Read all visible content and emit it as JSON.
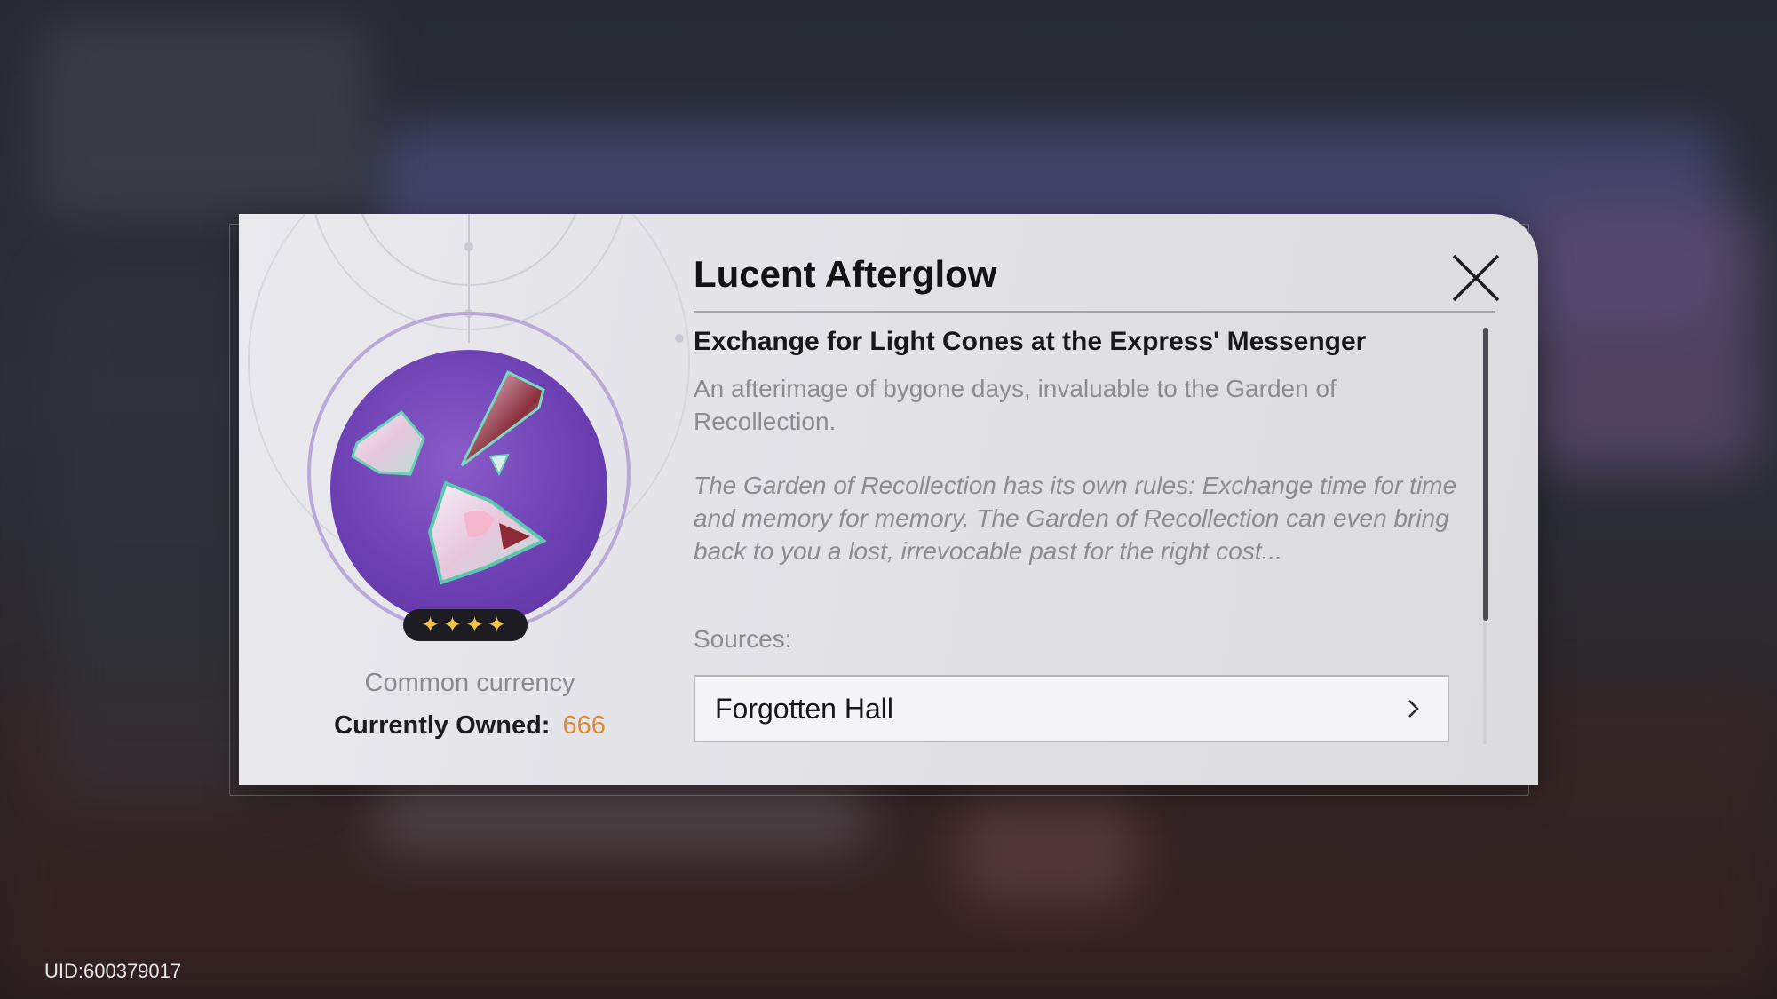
{
  "item": {
    "name": "Lucent Afterglow",
    "rarity_stars": "✦✦✦✦",
    "currency_type": "Common currency",
    "owned_label": "Currently Owned:",
    "owned_value": "666",
    "subtitle": "Exchange for Light Cones at the Express' Messenger",
    "description": "An afterimage of bygone days, invaluable to the Garden of Recollection.",
    "lore": "The Garden of Recollection has its own rules: Exchange time for time and memory for memory. The Garden of Recollection can even bring back to you a lost, irrevocable past for the right cost...",
    "sources_label": "Sources:",
    "sources": [
      {
        "label": "Forgotten Hall"
      }
    ]
  },
  "icons": {
    "close": "close-icon",
    "chevron": "chevron-right-icon",
    "item": "lucent-afterglow-shards-icon"
  },
  "colors": {
    "accent_owned": "#e08a2c",
    "icon_disc": "#6c40b3",
    "star": "#f1c24c"
  },
  "footer": {
    "uid": "UID:600379017"
  }
}
